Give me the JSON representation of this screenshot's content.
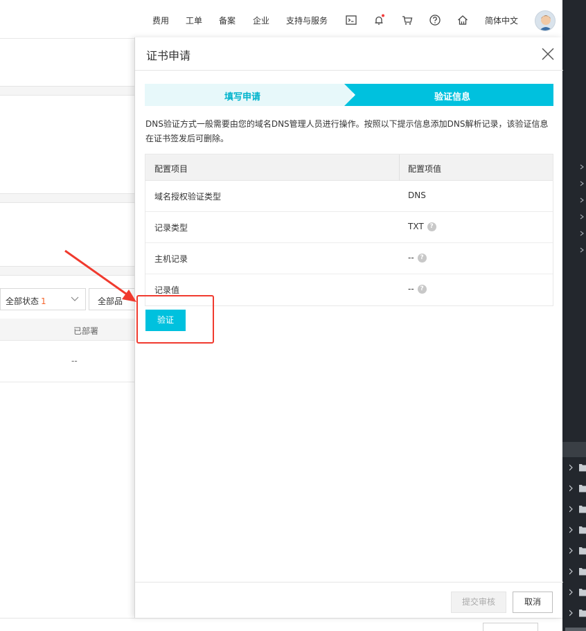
{
  "nav": {
    "items": [
      "费用",
      "工单",
      "备案",
      "企业",
      "支持与服务"
    ],
    "lang": "简体中文"
  },
  "background": {
    "status_filter_label": "全部状态",
    "status_filter_count": "1",
    "product_filter_label": "全部品",
    "column_deployed": "已部署",
    "cell_deployed": "--"
  },
  "drawer": {
    "title": "证书申请",
    "steps": [
      {
        "label": "填写申请",
        "state": "done"
      },
      {
        "label": "验证信息",
        "state": "active"
      }
    ],
    "description": "DNS验证方式一般需要由您的域名DNS管理人员进行操作。按照以下提示信息添加DNS解析记录，该验证信息在证书签发后可删除。",
    "table": {
      "headers": [
        "配置项目",
        "配置项值"
      ],
      "rows": [
        {
          "name": "域名授权验证类型",
          "value": "DNS",
          "help": false
        },
        {
          "name": "记录类型",
          "value": "TXT",
          "help": true
        },
        {
          "name": "主机记录",
          "value": "--",
          "help": true
        },
        {
          "name": "记录值",
          "value": "--",
          "help": true
        }
      ]
    },
    "verify_label": "验证",
    "submit_label": "提交审核",
    "cancel_label": "取消"
  },
  "colors": {
    "accent": "#00c1de",
    "annotation": "#f03a2e",
    "step_done_bg": "#e7f8fa",
    "dark_panel": "#23272d"
  },
  "icons": {
    "nav": [
      "terminal-icon",
      "bell-icon",
      "cart-icon",
      "help-circle-icon",
      "home-icon"
    ],
    "close": "close-icon",
    "help": "question-icon"
  }
}
